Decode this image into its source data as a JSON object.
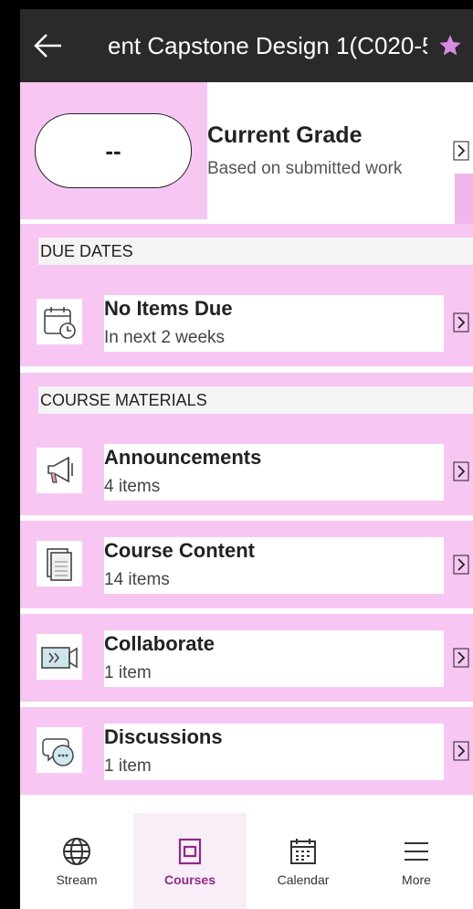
{
  "header": {
    "title": "ent Capstone Design 1(C020-5"
  },
  "grade": {
    "value": "--",
    "title": "Current Grade",
    "subtitle": "Based on submitted work"
  },
  "due_dates": {
    "section_label": "DUE DATES",
    "item": {
      "title": "No Items Due",
      "subtitle": "In next 2 weeks"
    }
  },
  "course_materials": {
    "section_label": "COURSE MATERIALS",
    "items": [
      {
        "title": "Announcements",
        "subtitle": "4 items"
      },
      {
        "title": "Course Content",
        "subtitle": "14 items"
      },
      {
        "title": "Collaborate",
        "subtitle": "1 item"
      },
      {
        "title": "Discussions",
        "subtitle": "1 item"
      }
    ]
  },
  "nav": {
    "items": [
      {
        "label": "Stream"
      },
      {
        "label": "Courses"
      },
      {
        "label": "Calendar"
      },
      {
        "label": "More"
      }
    ]
  },
  "colors": {
    "header_bg": "#2a2a2a",
    "star": "#d58be0",
    "accent": "#8e2b84"
  }
}
